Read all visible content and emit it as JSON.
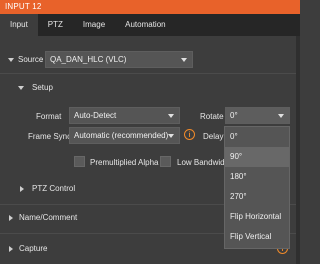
{
  "window": {
    "title": "INPUT 12"
  },
  "tabs": [
    {
      "label": "Input"
    },
    {
      "label": "PTZ"
    },
    {
      "label": "Image"
    },
    {
      "label": "Automation"
    }
  ],
  "source": {
    "label": "Source",
    "value": "QA_DAN_HLC (VLC)"
  },
  "setup": {
    "title": "Setup",
    "format_label": "Format",
    "format_value": "Auto-Detect",
    "rotate_label": "Rotate",
    "rotate_value": "0°",
    "frame_sync_label": "Frame Sync",
    "frame_sync_value": "Automatic (recommended)",
    "delay_label": "Delay",
    "premultiplied_alpha_label": "Premultiplied Alpha",
    "low_bandwidth_label": "Low Bandwidth"
  },
  "ptz_control": {
    "title": "PTZ Control"
  },
  "name_comment": {
    "title": "Name/Comment"
  },
  "capture": {
    "title": "Capture"
  },
  "rotate_menu": {
    "options": [
      "0°",
      "90°",
      "180°",
      "270°",
      "Flip Horizontal",
      "Flip Vertical"
    ],
    "highlighted": "90°"
  },
  "colors": {
    "accent": "#e8622a",
    "panel": "#3d3d3d",
    "tabbar": "#262626",
    "info": "#f08a2a"
  }
}
